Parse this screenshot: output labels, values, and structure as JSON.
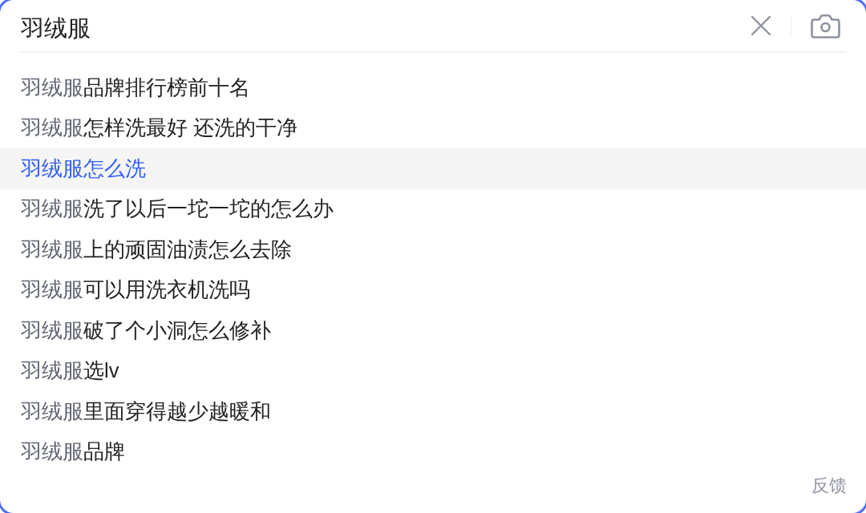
{
  "search": {
    "value": "羽绒服"
  },
  "suggestions": [
    {
      "match": "羽绒服",
      "completion": "品牌排行榜前十名",
      "selected": false
    },
    {
      "match": "羽绒服",
      "completion": "怎样洗最好 还洗的干净",
      "selected": false
    },
    {
      "match": "羽绒服",
      "completion": "怎么洗",
      "selected": true
    },
    {
      "match": "羽绒服",
      "completion": "洗了以后一坨一坨的怎么办",
      "selected": false
    },
    {
      "match": "羽绒服",
      "completion": "上的顽固油渍怎么去除",
      "selected": false
    },
    {
      "match": "羽绒服",
      "completion": "可以用洗衣机洗吗",
      "selected": false
    },
    {
      "match": "羽绒服",
      "completion": "破了个小洞怎么修补",
      "selected": false
    },
    {
      "match": "羽绒服",
      "completion": "选lv",
      "selected": false
    },
    {
      "match": "羽绒服",
      "completion": "里面穿得越少越暖和",
      "selected": false
    },
    {
      "match": "羽绒服",
      "completion": "品牌",
      "selected": false
    }
  ],
  "feedback_link": "反馈"
}
